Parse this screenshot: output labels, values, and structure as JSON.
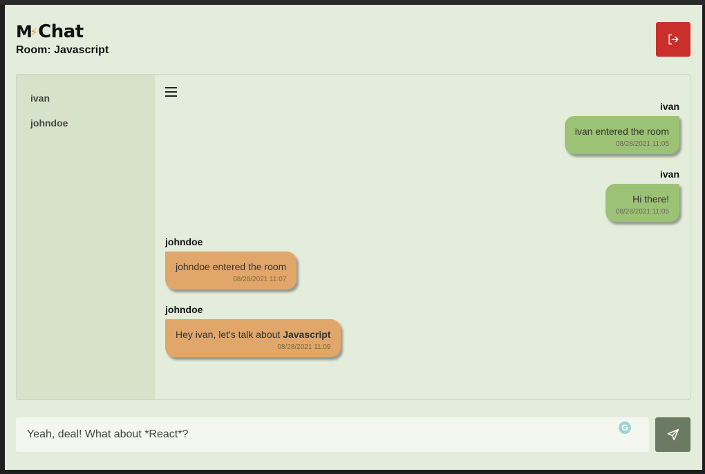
{
  "app": {
    "logo_left": "M",
    "logo_right": "Chat",
    "room_title": "Room: Javascript"
  },
  "users": [
    {
      "name": "ivan"
    },
    {
      "name": "johndoe"
    }
  ],
  "messages": [
    {
      "author": "ivan",
      "text": "ivan entered the room",
      "time": "08/28/2021 11:05",
      "side": "right"
    },
    {
      "author": "ivan",
      "text": "Hi there!",
      "time": "08/28/2021 11:05",
      "side": "right"
    },
    {
      "author": "johndoe",
      "text": "johndoe entered the room",
      "time": "08/28/2021 11:07",
      "side": "left"
    },
    {
      "author": "johndoe",
      "text_prefix": "Hey ivan, let's talk about ",
      "text_bold": "Javascript",
      "time": "08/28/2021 11:09",
      "side": "left"
    }
  ],
  "composer": {
    "value": "Yeah, deal! What about *React*?",
    "grammar_badge": "G"
  },
  "icons": {
    "logout": "logout-icon",
    "send": "send-icon",
    "menu": "menu-icon"
  },
  "colors": {
    "logout_bg": "#c9302c",
    "mine_bubble": "#9cc275",
    "theirs_bubble": "#e0a66a",
    "send_bg": "#6b7a62"
  }
}
